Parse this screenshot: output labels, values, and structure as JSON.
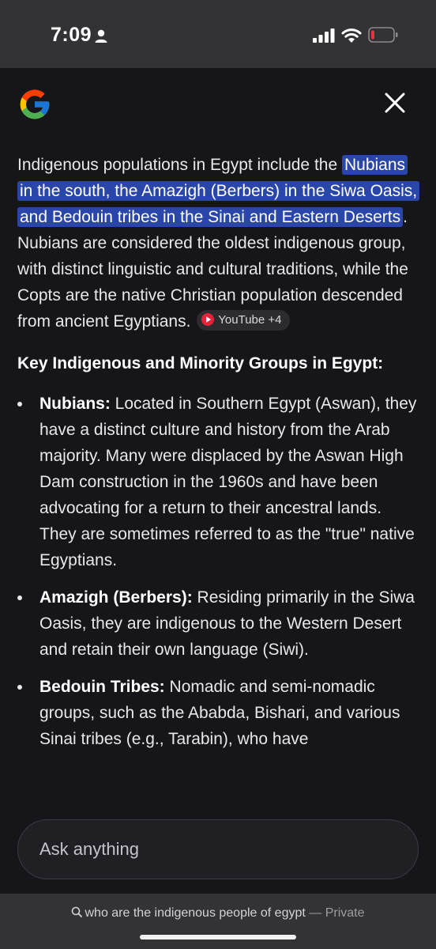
{
  "status_bar": {
    "time": "7:09"
  },
  "icons": {
    "person": "person-icon",
    "signal": "cellular-signal-icon",
    "wifi": "wifi-icon",
    "battery": "battery-low-icon",
    "logo": "google-g-logo",
    "close": "close-icon",
    "search": "search-icon",
    "youtube": "youtube-icon"
  },
  "colors": {
    "highlight": "#2a46a8",
    "youtube_red": "#e4233a",
    "battery_red": "#e5343a"
  },
  "answer": {
    "intro_before": "Indigenous populations in Egypt include the ",
    "intro_highlight": "Nubians in the south, the Amazigh (Berbers) in the Siwa Oasis, and Bedouin tribes in the Sinai and Eastern Deserts",
    "intro_after": ". Nubians are considered the oldest indigenous group, with distinct linguistic and cultural traditions, while the Copts are the native Christian population descended from ancient Egyptians.",
    "source_chip": "YouTube +4",
    "heading": "Key Indigenous and Minority Groups in Egypt:",
    "groups": [
      {
        "name": "Nubians:",
        "text": " Located in Southern Egypt (Aswan), they have a distinct culture and history from the Arab majority. Many were displaced by the Aswan High Dam construction in the 1960s and have been advocating for a return to their ancestral lands. They are sometimes referred to as the \"true\" native Egyptians."
      },
      {
        "name": "Amazigh (Berbers):",
        "text": " Residing primarily in the Siwa Oasis, they are indigenous to the Western Desert and retain their own language (Siwi)."
      },
      {
        "name": "Bedouin Tribes:",
        "text": " Nomadic and semi-nomadic groups, such as the Ababda, Bishari, and various Sinai tribes (e.g., Tarabin), who have"
      }
    ]
  },
  "ask": {
    "placeholder": "Ask anything"
  },
  "bottom": {
    "query": "who are the indigenous people of egypt",
    "separator": " — ",
    "mode": "Private"
  }
}
